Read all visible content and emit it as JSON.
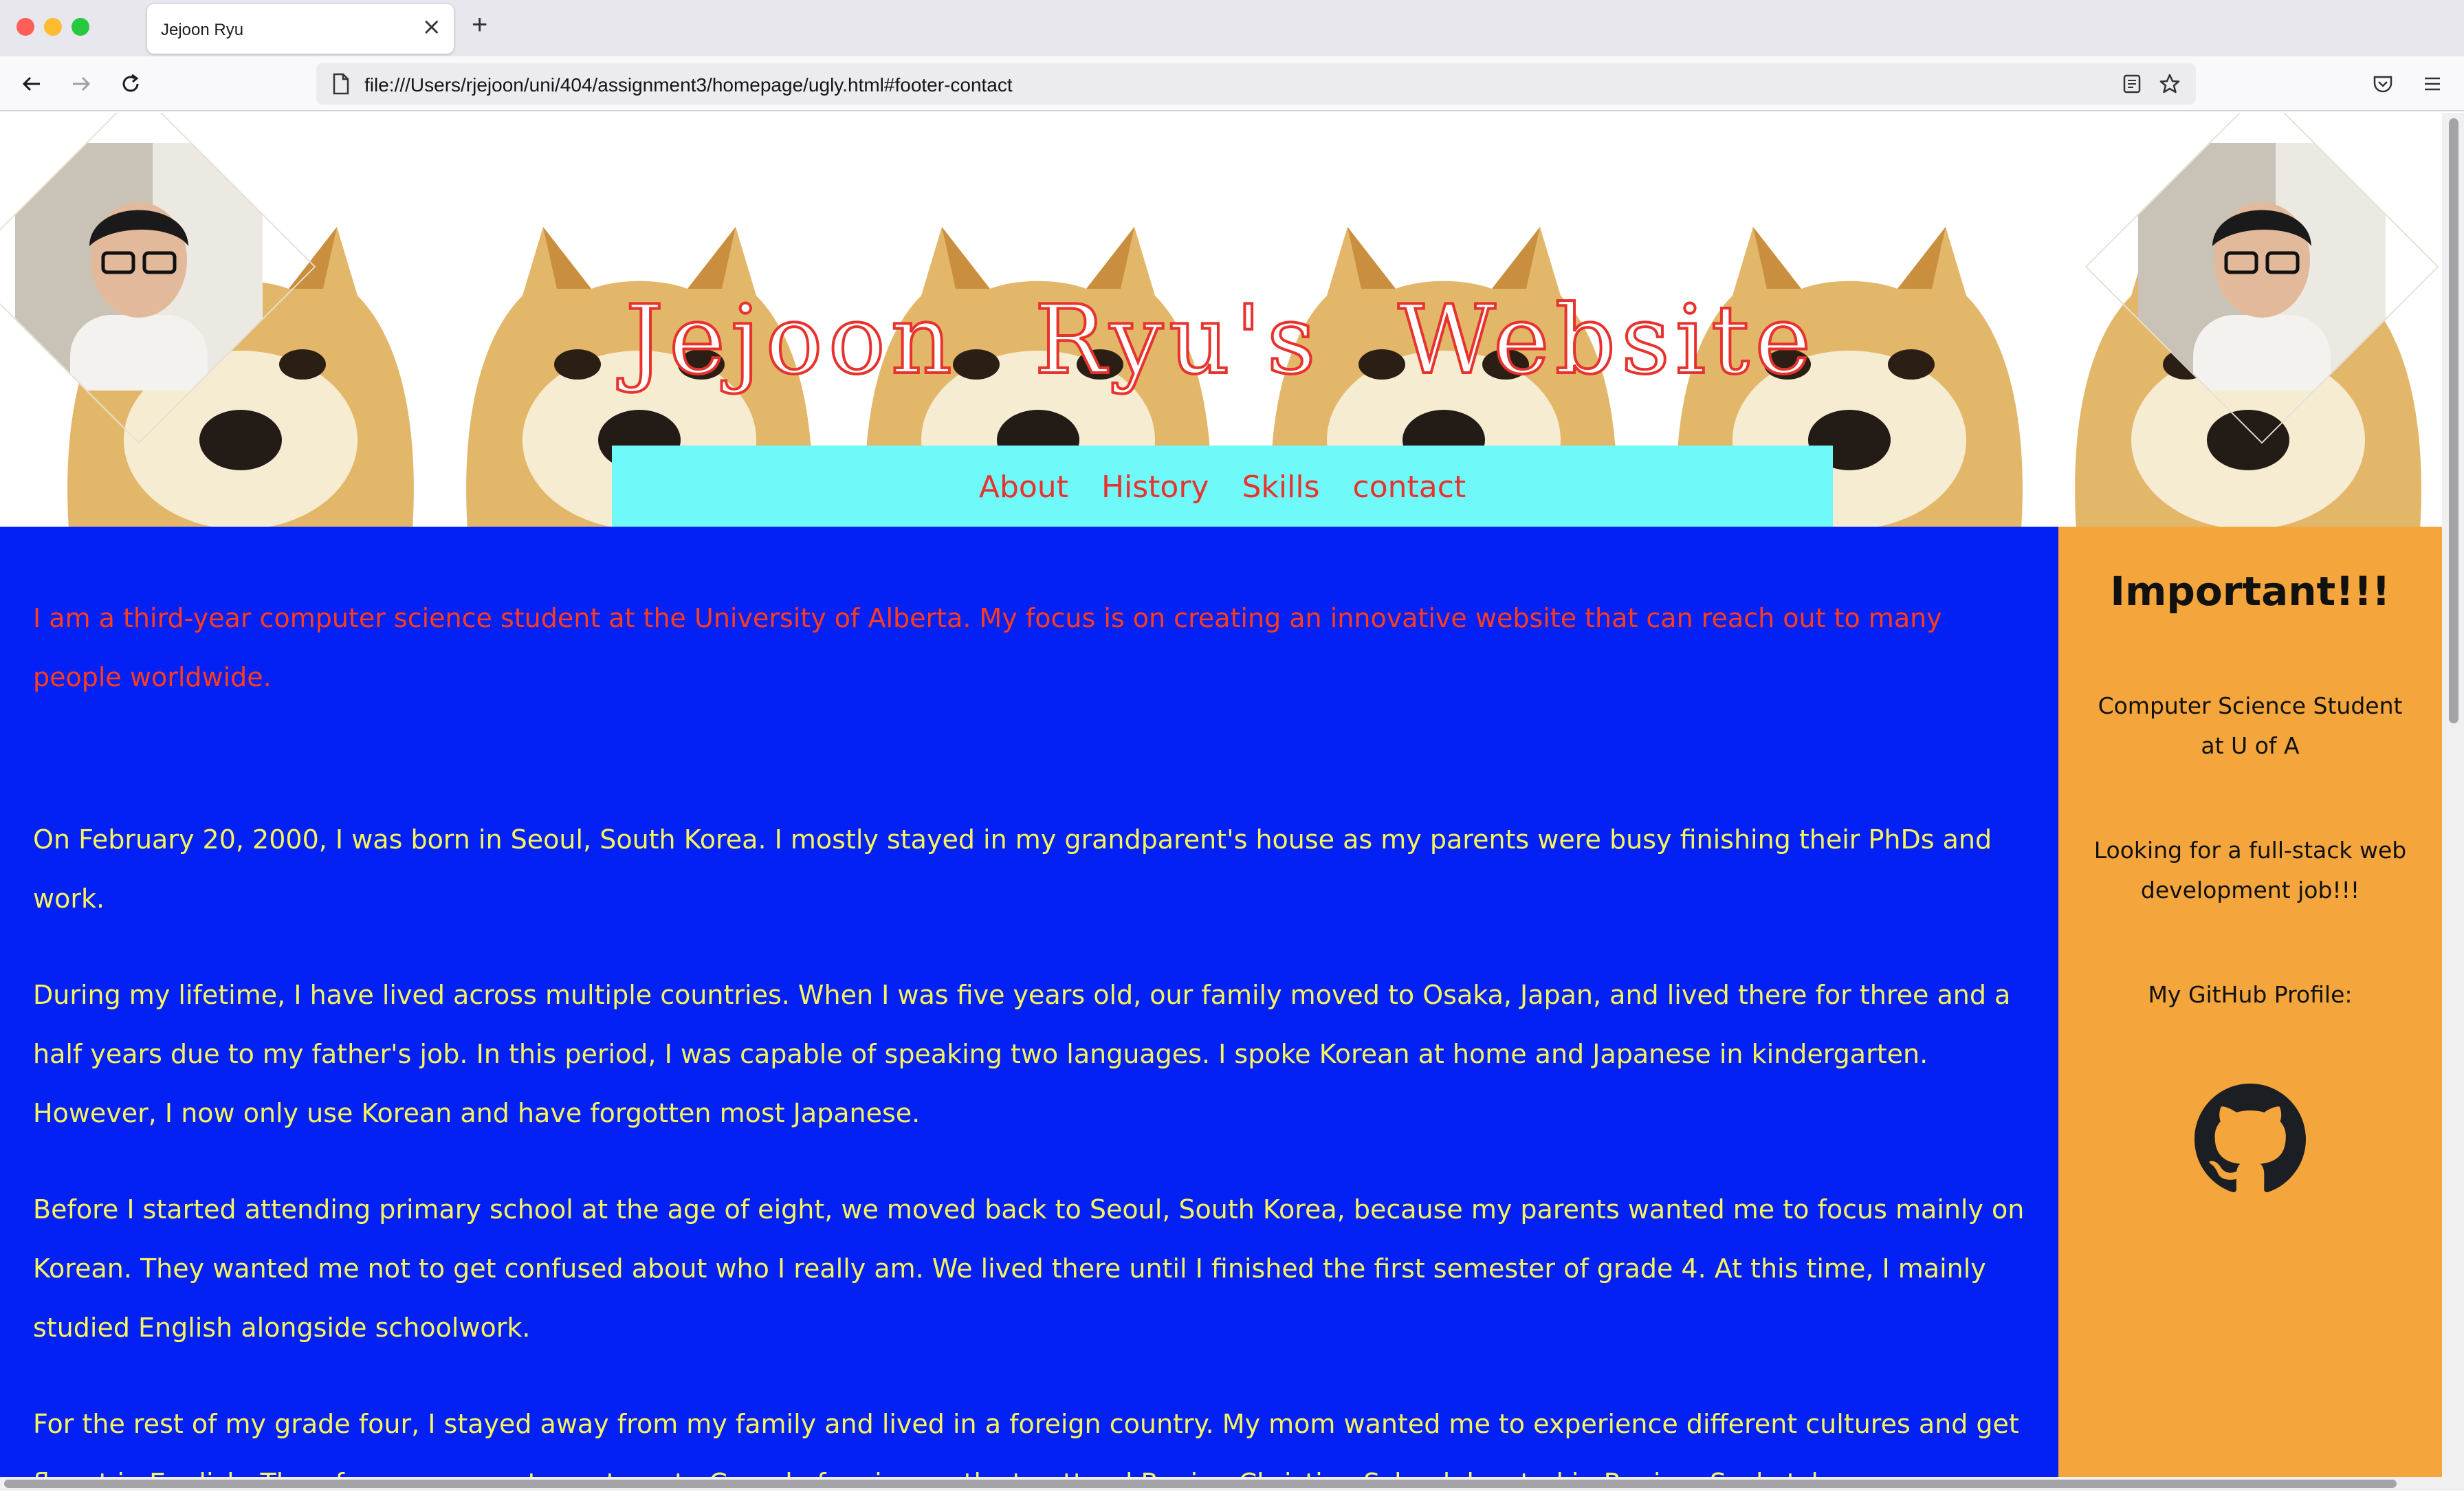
{
  "browser": {
    "tab_title": "Jejoon Ryu",
    "url": "file:///Users/rjejoon/uni/404/assignment3/homepage/ugly.html#footer-contact"
  },
  "header": {
    "title": "Jejoon Ryu's Website",
    "nav": [
      "About",
      "History",
      "Skills",
      "contact"
    ]
  },
  "main": {
    "intro": "I am a third-year computer science student at the University of Alberta. My focus is on creating an innovative website that can reach out to many people worldwide.",
    "paragraphs": [
      "On February 20, 2000, I was born in Seoul, South Korea. I mostly stayed in my grandparent's house as my parents were busy finishing their PhDs and work.",
      "During my lifetime, I have lived across multiple countries. When I was five years old, our family moved to Osaka, Japan, and lived there for three and a half years due to my father's job. In this period, I was capable of speaking two languages. I spoke Korean at home and Japanese in kindergarten. However, I now only use Korean and have forgotten most Japanese.",
      "Before I started attending primary school at the age of eight, we moved back to Seoul, South Korea, because my parents wanted me to focus mainly on Korean. They wanted me not to get confused about who I really am. We lived there until I finished the first semester of grade 4. At this time, I mainly studied English alongside schoolwork.",
      "For the rest of my grade four, I stayed away from my family and lived in a foreign country. My mom wanted me to experience different cultures and get fluent in English. Therefore, my parents sent me to Canada for six months to attend Regina Christian School, located in Regina, Saskatchewan."
    ]
  },
  "aside": {
    "heading": "Important!!!",
    "line1": "Computer Science Student at U of A",
    "line2": "Looking for a full-stack web development job!!!",
    "line3": "My GitHub Profile:",
    "github_icon": "github-icon"
  },
  "colors": {
    "main_bg": "#0320f5",
    "main_text": "#f8f55a",
    "intro_text": "#ff3d1a",
    "aside_bg": "#f4a63c",
    "nav_bg": "#6ff9f9",
    "accent_red": "#e8322d"
  }
}
